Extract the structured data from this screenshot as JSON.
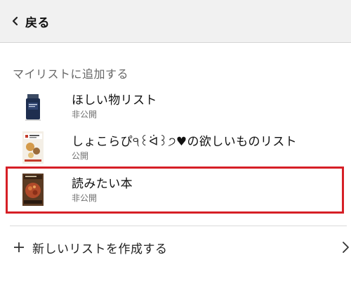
{
  "header": {
    "back_label": "戻る",
    "back_icon": "chevron-left-icon"
  },
  "section_title": "マイリストに追加する",
  "lists": [
    {
      "name": "ほしい物リスト",
      "visibility": "非公開",
      "thumbnail": "product-bottle-thumbnail"
    },
    {
      "name": "しょこらぴ੧꒰ᐛ꒱੭♥︎の欲しいものリスト",
      "visibility": "公開",
      "thumbnail": "book-cover-thumbnail"
    },
    {
      "name": "読みたい本",
      "visibility": "非公開",
      "thumbnail": "cookbook-cover-thumbnail",
      "highlighted": true
    }
  ],
  "create_list": {
    "label": "新しいリストを作成する",
    "leading_icon": "plus-icon",
    "trailing_icon": "chevron-right-icon"
  },
  "colors": {
    "header_bg": "#f1f1f1",
    "highlight_border": "#d61f26",
    "secondary_text": "#6f6f6f"
  }
}
